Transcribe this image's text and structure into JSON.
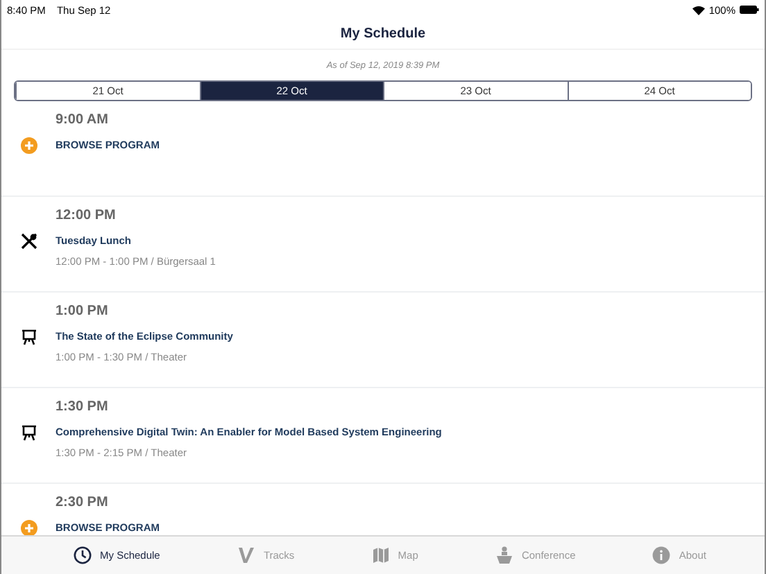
{
  "status_bar": {
    "time": "8:40 PM",
    "date": "Thu Sep 12",
    "battery": "100%"
  },
  "nav_bar": {
    "title": "My Schedule"
  },
  "updated": "As of Sep 12, 2019 8:39 PM",
  "day_tabs": [
    {
      "label": "21 Oct",
      "selected": false
    },
    {
      "label": "22 Oct",
      "selected": true
    },
    {
      "label": "23 Oct",
      "selected": false
    },
    {
      "label": "24 Oct",
      "selected": false
    }
  ],
  "slots": [
    {
      "time": "9:00 AM",
      "item": {
        "kind": "browse",
        "title": "BROWSE PROGRAM"
      }
    },
    {
      "time": "12:00 PM",
      "item": {
        "kind": "meal",
        "title": "Tuesday Lunch",
        "details": "12:00 PM - 1:00 PM / Bürgersaal 1"
      }
    },
    {
      "time": "1:00 PM",
      "item": {
        "kind": "talk",
        "title": "The State of the Eclipse Community",
        "details": "1:00 PM - 1:30 PM / Theater"
      }
    },
    {
      "time": "1:30 PM",
      "item": {
        "kind": "talk",
        "title": "Comprehensive Digital Twin: An Enabler for Model Based System Engineering",
        "details": "1:30 PM - 2:15 PM / Theater"
      }
    },
    {
      "time": "2:30 PM",
      "item": {
        "kind": "browse",
        "title": "BROWSE PROGRAM"
      }
    }
  ],
  "tab_bar": [
    {
      "kind": "schedule",
      "label": "My Schedule",
      "selected": true
    },
    {
      "kind": "tracks",
      "label": "Tracks",
      "selected": false
    },
    {
      "kind": "map",
      "label": "Map",
      "selected": false
    },
    {
      "kind": "conference",
      "label": "Conference",
      "selected": false
    },
    {
      "kind": "about",
      "label": "About",
      "selected": false
    }
  ]
}
